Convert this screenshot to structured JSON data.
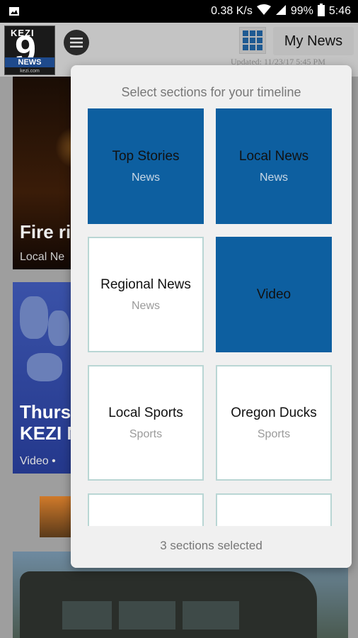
{
  "status_bar": {
    "speed": "0.38 K/s",
    "battery": "99%",
    "time": "5:46"
  },
  "header": {
    "logo": {
      "line1": "KEZI",
      "digit": "9",
      "line2": "NEWS",
      "url": "kezi.com"
    },
    "my_news_label": "My News",
    "updated": "Updated: 11/23/17 5:45 PM"
  },
  "feed": [
    {
      "title": "Fire ri",
      "tag": "Local Ne"
    },
    {
      "title_line1": "Thurs",
      "title_line2": "KEZI N",
      "tag": "Video •"
    }
  ],
  "modal": {
    "title": "Select sections for your timeline",
    "sections": [
      {
        "name": "Top Stories",
        "category": "News",
        "selected": true
      },
      {
        "name": "Local News",
        "category": "News",
        "selected": true
      },
      {
        "name": "Regional News",
        "category": "News",
        "selected": false
      },
      {
        "name": "Video",
        "category": "",
        "selected": true
      },
      {
        "name": "Local Sports",
        "category": "Sports",
        "selected": false
      },
      {
        "name": "Oregon Ducks",
        "category": "Sports",
        "selected": false
      },
      {
        "name": "",
        "category": "",
        "selected": false
      },
      {
        "name": "",
        "category": "",
        "selected": false
      }
    ],
    "footer": "3 sections selected"
  },
  "colors": {
    "selected_tile": "#0d5fa0",
    "unselected_border": "#b9d6d4"
  }
}
